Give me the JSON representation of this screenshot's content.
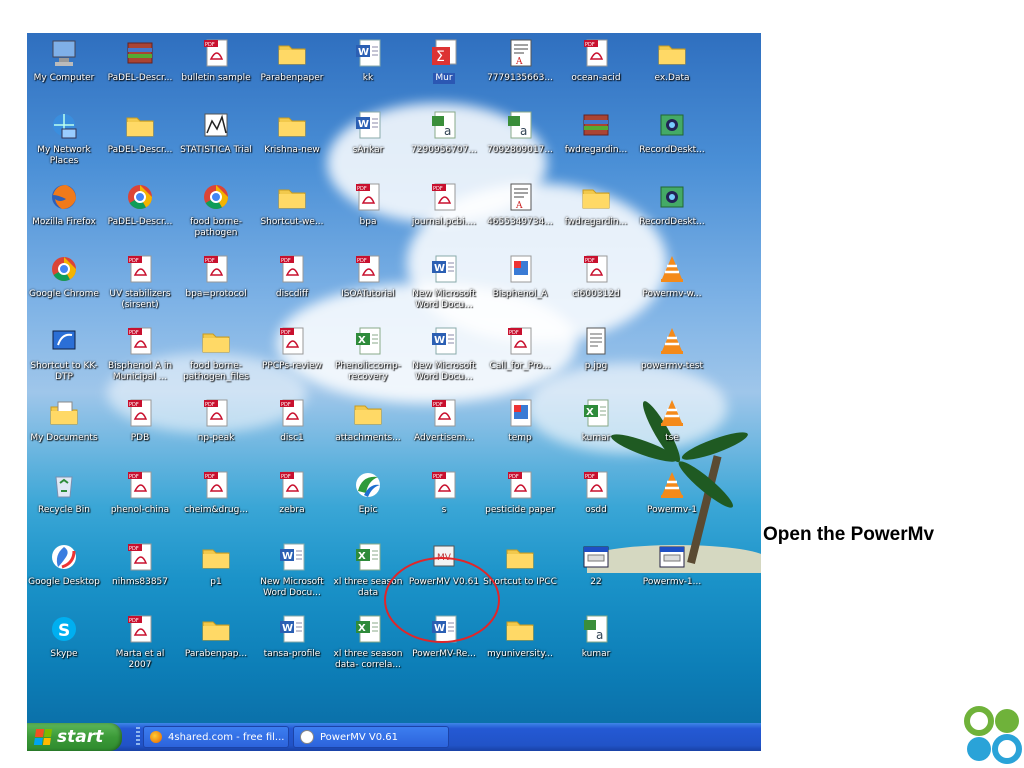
{
  "desktop": {
    "icons": [
      {
        "label": "My Computer",
        "type": "computer"
      },
      {
        "label": "PaDEL-Descr...",
        "type": "archive"
      },
      {
        "label": "bulletin sample",
        "type": "pdf"
      },
      {
        "label": "Parabenpaper",
        "type": "folder"
      },
      {
        "label": "kk",
        "type": "word"
      },
      {
        "label": "Mur",
        "type": "sigma"
      },
      {
        "label": "7779135663...",
        "type": "doc"
      },
      {
        "label": "ocean-acid",
        "type": "pdf"
      },
      {
        "label": "ex.Data",
        "type": "folder"
      },
      {
        "label": "My Network Places",
        "type": "network"
      },
      {
        "label": "PaDEL-Descr...",
        "type": "folder"
      },
      {
        "label": "STATISTICA Trial",
        "type": "stats"
      },
      {
        "label": "Krishna-new",
        "type": "folder"
      },
      {
        "label": "sAnkar",
        "type": "word"
      },
      {
        "label": "7290956707...",
        "type": "image"
      },
      {
        "label": "7092809017...",
        "type": "image"
      },
      {
        "label": "fwdregardin...",
        "type": "archive"
      },
      {
        "label": "RecordDeskt...",
        "type": "camera"
      },
      {
        "label": "Mozilla Firefox",
        "type": "firefox"
      },
      {
        "label": "PaDEL-Descr...",
        "type": "chrome"
      },
      {
        "label": "food borne-pathogen",
        "type": "chrome"
      },
      {
        "label": "Shortcut-we...",
        "type": "folder"
      },
      {
        "label": "bpa",
        "type": "pdf"
      },
      {
        "label": "journal.pcbi....",
        "type": "pdf"
      },
      {
        "label": "4655349734...",
        "type": "doc"
      },
      {
        "label": "fwdregardin...",
        "type": "folder"
      },
      {
        "label": "RecordDeskt...",
        "type": "camera"
      },
      {
        "label": "Google Chrome",
        "type": "chrome"
      },
      {
        "label": "UV stabilizers (sirsent)",
        "type": "pdf"
      },
      {
        "label": "bpa=protocol",
        "type": "pdf"
      },
      {
        "label": "discdiff",
        "type": "pdf"
      },
      {
        "label": "ISOATutorial",
        "type": "pdf"
      },
      {
        "label": "New Microsoft Word Docu...",
        "type": "word"
      },
      {
        "label": "Bisphenol_A",
        "type": "paint"
      },
      {
        "label": "ci600312d",
        "type": "pdf"
      },
      {
        "label": "Powermv-w...",
        "type": "vlc"
      },
      {
        "label": "Shortcut to KK-DTP",
        "type": "shortcut"
      },
      {
        "label": "Bisphenol A in Municipal ...",
        "type": "pdf"
      },
      {
        "label": "food borne-pathogen_files",
        "type": "folder"
      },
      {
        "label": "PPCPs-review",
        "type": "pdf"
      },
      {
        "label": "Phenoliccomp-recovery",
        "type": "excel"
      },
      {
        "label": "New Microsoft Word Docu...",
        "type": "word"
      },
      {
        "label": "Call_for_Pro...",
        "type": "pdf"
      },
      {
        "label": "p.jpg",
        "type": "text"
      },
      {
        "label": "powermv-test",
        "type": "vlc"
      },
      {
        "label": "My Documents",
        "type": "mydocs"
      },
      {
        "label": "PDB",
        "type": "pdf"
      },
      {
        "label": "np-peak",
        "type": "pdf"
      },
      {
        "label": "disc1",
        "type": "pdf"
      },
      {
        "label": "attachments...",
        "type": "folder"
      },
      {
        "label": "Advertisem...",
        "type": "pdf"
      },
      {
        "label": "temp",
        "type": "paint"
      },
      {
        "label": "kumar",
        "type": "excel"
      },
      {
        "label": "tse",
        "type": "vlc"
      },
      {
        "label": "Recycle Bin",
        "type": "recycle"
      },
      {
        "label": "phenol-china",
        "type": "pdf"
      },
      {
        "label": "cheim&drug...",
        "type": "pdf"
      },
      {
        "label": "zebra",
        "type": "pdf"
      },
      {
        "label": "Epic",
        "type": "epic"
      },
      {
        "label": "s",
        "type": "pdf"
      },
      {
        "label": "pesticide paper",
        "type": "pdf"
      },
      {
        "label": "osdd",
        "type": "pdf"
      },
      {
        "label": "Powermv-1",
        "type": "vlc"
      },
      {
        "label": "Google Desktop",
        "type": "gdesktop"
      },
      {
        "label": "nihms83857",
        "type": "pdf"
      },
      {
        "label": "p1",
        "type": "folder"
      },
      {
        "label": "New Microsoft Word Docu...",
        "type": "word"
      },
      {
        "label": "xl three season data",
        "type": "excel"
      },
      {
        "label": "PowerMV V0.61",
        "type": "powermv"
      },
      {
        "label": "Shortcut to IPCC",
        "type": "folder"
      },
      {
        "label": "22",
        "type": "window"
      },
      {
        "label": "Powermv-1...",
        "type": "window"
      },
      {
        "label": "Skype",
        "type": "skype"
      },
      {
        "label": "Marta et al 2007",
        "type": "pdf"
      },
      {
        "label": "Parabenpap...",
        "type": "folder"
      },
      {
        "label": "tansa-profile",
        "type": "word"
      },
      {
        "label": "xl three season data- correla...",
        "type": "excel"
      },
      {
        "label": "PowerMV-Re...",
        "type": "word"
      },
      {
        "label": "myuniversity...",
        "type": "folder"
      },
      {
        "label": "kumar",
        "type": "image"
      }
    ]
  },
  "taskbar": {
    "start_label": "start",
    "tasks": [
      {
        "label": "4shared.com - free fil...",
        "icon": "firefox-icon"
      },
      {
        "label": "PowerMV V0.61",
        "icon": "powermv-icon"
      }
    ]
  },
  "slide": {
    "caption": "Open the PowerMv"
  },
  "colors": {
    "taskbar_blue": "#2459d4",
    "start_green": "#3c9a38",
    "highlight_red": "#e0262a",
    "logo_green": "#6fb23a",
    "logo_blue": "#2aa3d8"
  }
}
